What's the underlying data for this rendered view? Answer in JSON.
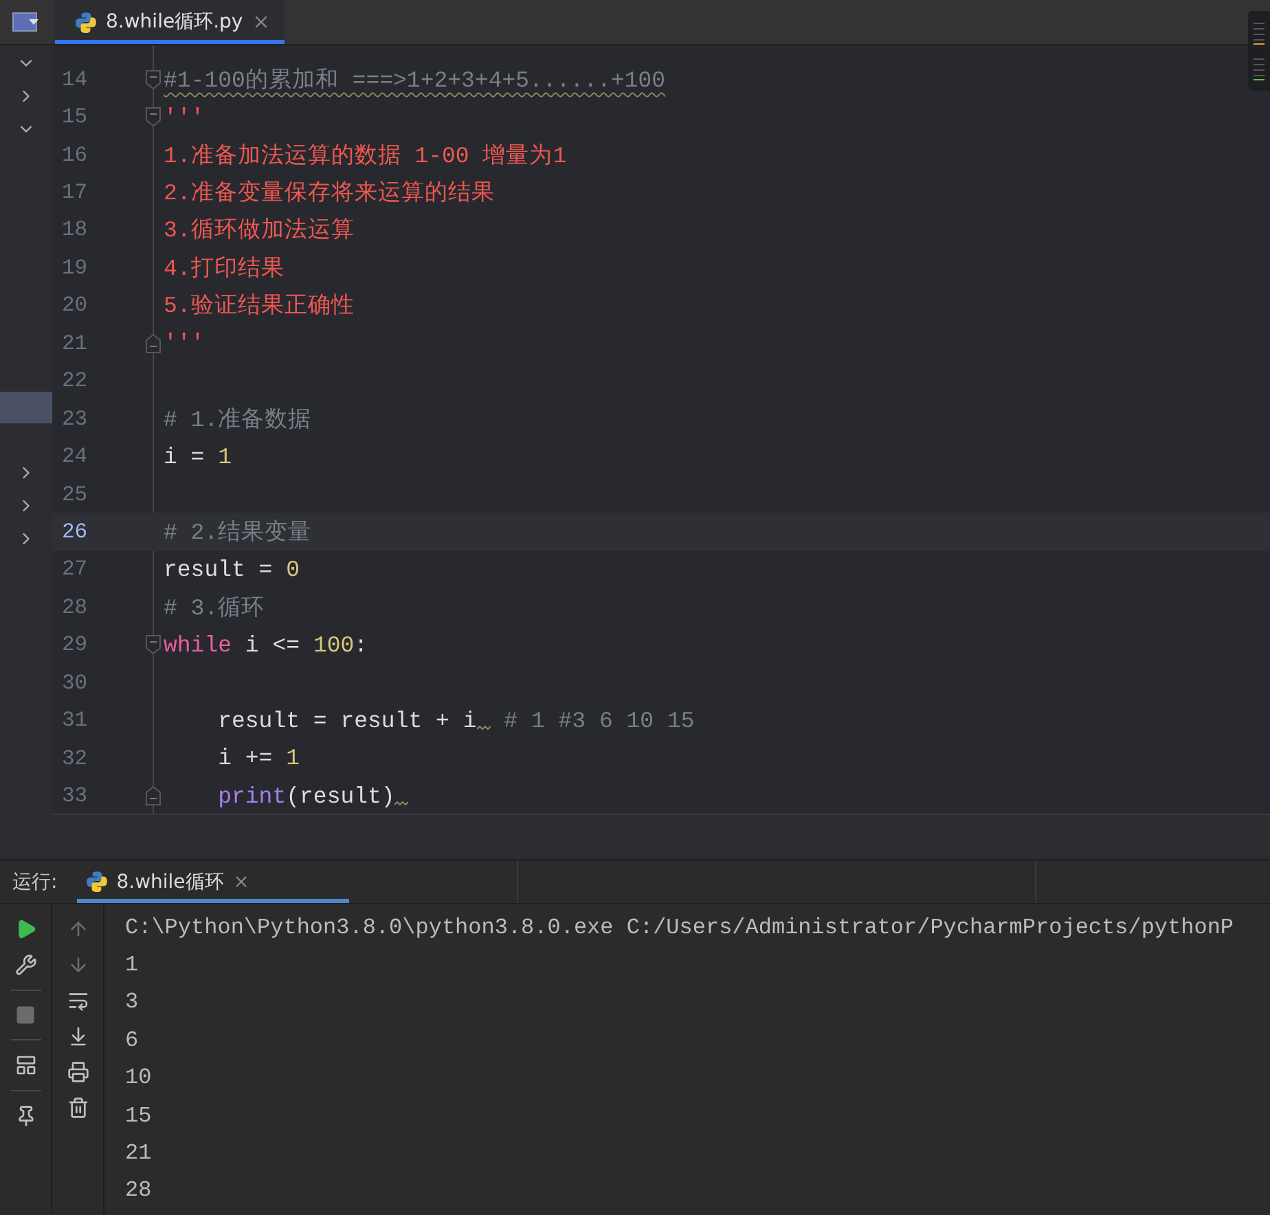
{
  "editor_tab": {
    "label": "8.while循环.py",
    "selected": true
  },
  "editor": {
    "lines": [
      {
        "number": "14",
        "fold_start": true,
        "current": false,
        "tokens": [
          {
            "kind": "comment",
            "text": "#1-100的累加和 ===>1+2+3+4+5......+100",
            "warn": true
          }
        ]
      },
      {
        "number": "15",
        "fold_start": true,
        "current": false,
        "tokens": [
          {
            "kind": "docstring",
            "text": "'''"
          }
        ]
      },
      {
        "number": "16",
        "current": false,
        "tokens": [
          {
            "kind": "docstring",
            "text": "1.准备加法运算的数据 1-00 增量为1"
          }
        ]
      },
      {
        "number": "17",
        "current": false,
        "tokens": [
          {
            "kind": "docstring",
            "text": "2.准备变量保存将来运算的结果"
          }
        ]
      },
      {
        "number": "18",
        "current": false,
        "tokens": [
          {
            "kind": "docstring",
            "text": "3.循环做加法运算"
          }
        ]
      },
      {
        "number": "19",
        "current": false,
        "tokens": [
          {
            "kind": "docstring",
            "text": "4.打印结果"
          }
        ]
      },
      {
        "number": "20",
        "current": false,
        "tokens": [
          {
            "kind": "docstring",
            "text": "5.验证结果正确性"
          }
        ]
      },
      {
        "number": "21",
        "fold_end": true,
        "current": false,
        "tokens": [
          {
            "kind": "docstring",
            "text": "'''"
          }
        ]
      },
      {
        "number": "22",
        "current": false
      },
      {
        "number": "23",
        "current": false,
        "tokens": [
          {
            "kind": "comment",
            "text": "# 1.准备数据"
          }
        ]
      },
      {
        "number": "24",
        "current": false,
        "tokens": [
          {
            "kind": "plain",
            "text": "i = "
          },
          {
            "kind": "number",
            "text": "1"
          }
        ]
      },
      {
        "number": "25",
        "current": false
      },
      {
        "number": "26",
        "current": true,
        "tokens": [
          {
            "kind": "comment",
            "text": "# 2.结果变量"
          }
        ]
      },
      {
        "number": "27",
        "current": false,
        "tokens": [
          {
            "kind": "plain",
            "text": "result = "
          },
          {
            "kind": "number",
            "text": "0"
          }
        ]
      },
      {
        "number": "28",
        "current": false,
        "tokens": [
          {
            "kind": "comment",
            "text": "# 3.循环"
          }
        ]
      },
      {
        "number": "29",
        "fold_start": true,
        "current": false,
        "tokens": [
          {
            "kind": "keyword",
            "text": "while"
          },
          {
            "kind": "plain",
            "text": " i <= "
          },
          {
            "kind": "number",
            "text": "100"
          },
          {
            "kind": "plain",
            "text": ":"
          }
        ]
      },
      {
        "number": "30",
        "current": false
      },
      {
        "number": "31",
        "current": false,
        "tokens": [
          {
            "kind": "plain",
            "text": "    result = result + i",
            "warn_after": true
          },
          {
            "kind": "comment",
            "text": " # 1 #3 6 10 15"
          }
        ]
      },
      {
        "number": "32",
        "current": false,
        "tokens": [
          {
            "kind": "plain",
            "text": "    i += "
          },
          {
            "kind": "number",
            "text": "1"
          }
        ]
      },
      {
        "number": "33",
        "fold_end": true,
        "current": false,
        "tokens": [
          {
            "kind": "builtin",
            "text": "    print"
          },
          {
            "kind": "plain",
            "text": "(result)",
            "warn_after": true
          }
        ]
      }
    ]
  },
  "run_panel": {
    "label": "运行:",
    "tab": {
      "label": "8.while循环",
      "selected": true
    },
    "output": [
      "C:\\Python\\Python3.8.0\\python3.8.0.exe C:/Users/Administrator/PycharmProjects/pythonP",
      "1",
      "3",
      "6",
      "10",
      "15",
      "21",
      "28"
    ]
  }
}
